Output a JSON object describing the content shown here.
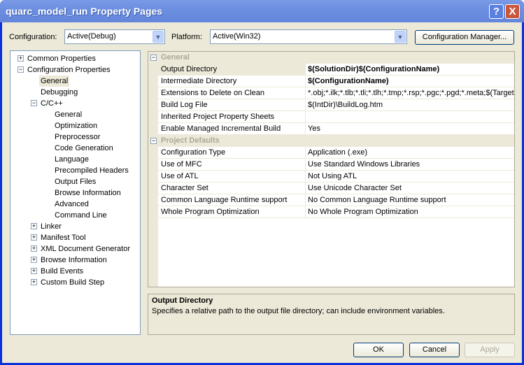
{
  "window": {
    "title": "quarc_model_run Property Pages",
    "help_glyph": "?",
    "close_glyph": "X"
  },
  "toolbar": {
    "configuration_label": "Configuration:",
    "configuration_value": "Active(Debug)",
    "platform_label": "Platform:",
    "platform_value": "Active(Win32)",
    "config_manager": "Configuration Manager..."
  },
  "tree": [
    {
      "label": "Common Properties",
      "level": 0,
      "toggle": "+"
    },
    {
      "label": "Configuration Properties",
      "level": 0,
      "toggle": "-"
    },
    {
      "label": "General",
      "level": 1,
      "selected": true
    },
    {
      "label": "Debugging",
      "level": 1
    },
    {
      "label": "C/C++",
      "level": 1,
      "toggle": "-"
    },
    {
      "label": "General",
      "level": 2
    },
    {
      "label": "Optimization",
      "level": 2
    },
    {
      "label": "Preprocessor",
      "level": 2
    },
    {
      "label": "Code Generation",
      "level": 2
    },
    {
      "label": "Language",
      "level": 2
    },
    {
      "label": "Precompiled Headers",
      "level": 2
    },
    {
      "label": "Output Files",
      "level": 2
    },
    {
      "label": "Browse Information",
      "level": 2
    },
    {
      "label": "Advanced",
      "level": 2
    },
    {
      "label": "Command Line",
      "level": 2
    },
    {
      "label": "Linker",
      "level": 1,
      "toggle": "+"
    },
    {
      "label": "Manifest Tool",
      "level": 1,
      "toggle": "+"
    },
    {
      "label": "XML Document Generator",
      "level": 1,
      "toggle": "+"
    },
    {
      "label": "Browse Information",
      "level": 1,
      "toggle": "+"
    },
    {
      "label": "Build Events",
      "level": 1,
      "toggle": "+"
    },
    {
      "label": "Custom Build Step",
      "level": 1,
      "toggle": "+"
    }
  ],
  "grid": [
    {
      "category": "General",
      "toggle": "-"
    },
    {
      "key": "Output Directory",
      "value": "$(SolutionDir)$(ConfigurationName)",
      "bold": true,
      "selected": true
    },
    {
      "key": "Intermediate Directory",
      "value": "$(ConfigurationName)",
      "bold": true
    },
    {
      "key": "Extensions to Delete on Clean",
      "value": "*.obj;*.ilk;*.tlb;*.tli;*.tlh;*.tmp;*.rsp;*.pgc;*.pgd;*.meta;$(TargetPath)"
    },
    {
      "key": "Build Log File",
      "value": "$(IntDir)\\BuildLog.htm"
    },
    {
      "key": "Inherited Project Property Sheets",
      "value": ""
    },
    {
      "key": "Enable Managed Incremental Build",
      "value": "Yes"
    },
    {
      "category": "Project Defaults",
      "toggle": "-"
    },
    {
      "key": "Configuration Type",
      "value": "Application (.exe)"
    },
    {
      "key": "Use of MFC",
      "value": "Use Standard Windows Libraries"
    },
    {
      "key": "Use of ATL",
      "value": "Not Using ATL"
    },
    {
      "key": "Character Set",
      "value": "Use Unicode Character Set"
    },
    {
      "key": "Common Language Runtime support",
      "value": "No Common Language Runtime support"
    },
    {
      "key": "Whole Program Optimization",
      "value": "No Whole Program Optimization"
    }
  ],
  "description": {
    "title": "Output Directory",
    "text": "Specifies a relative path to the output file directory; can include environment variables."
  },
  "buttons": {
    "ok": "OK",
    "cancel": "Cancel",
    "apply": "Apply"
  }
}
